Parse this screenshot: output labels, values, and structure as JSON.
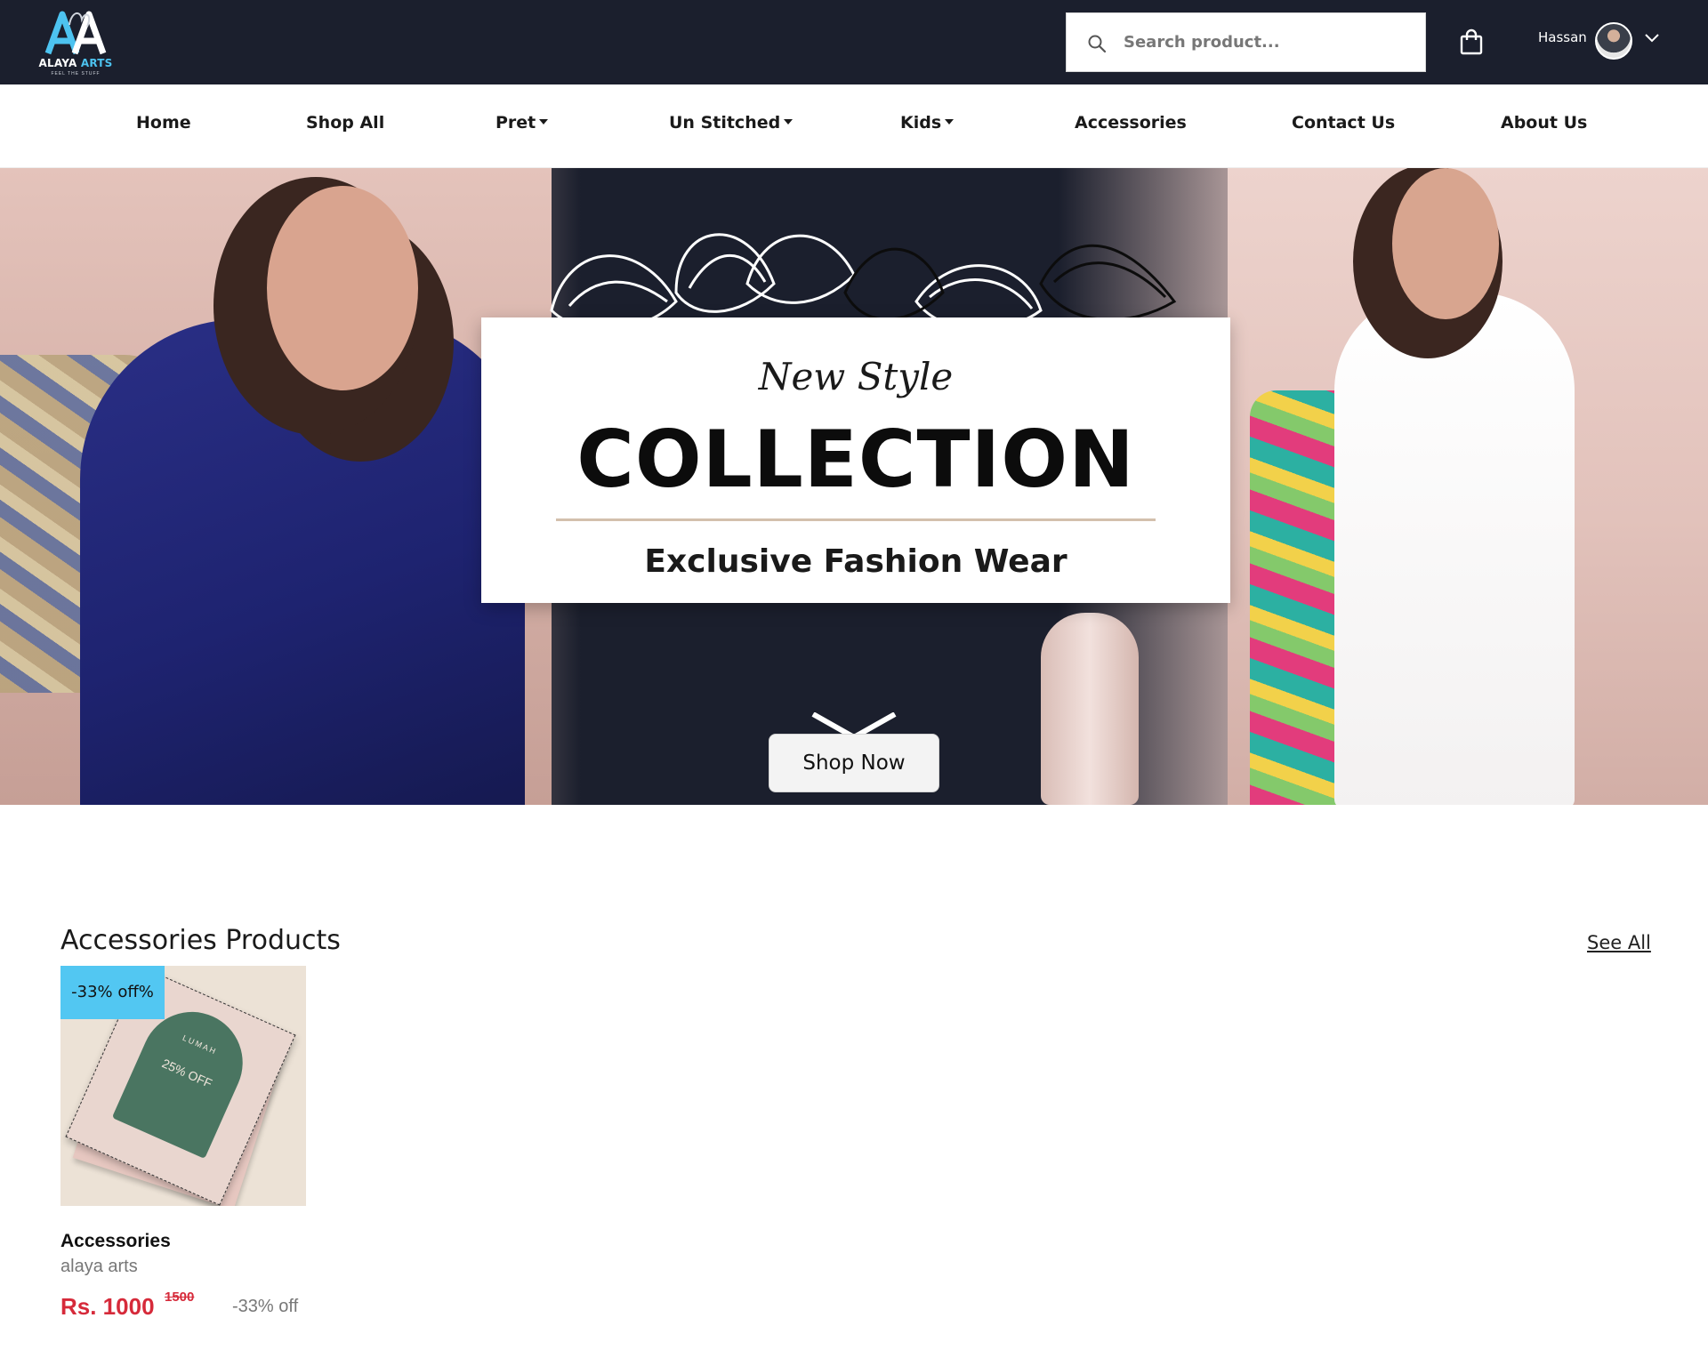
{
  "brand": {
    "name_part1": "ALAYA",
    "name_part2": "ARTS",
    "tagline": "FEEL THE STUFF",
    "accent_color": "#4dc3f0",
    "header_bg": "#1b1f2d"
  },
  "header": {
    "search": {
      "placeholder": "Search product..."
    },
    "cart_icon": "shopping-bag-icon",
    "user": {
      "name": "Hassan",
      "menu_icon": "chevron-down-icon"
    }
  },
  "nav": {
    "items": [
      {
        "label": "Home",
        "dropdown": false
      },
      {
        "label": "Shop All",
        "dropdown": false
      },
      {
        "label": "Pret",
        "dropdown": true
      },
      {
        "label": "Un Stitched",
        "dropdown": true
      },
      {
        "label": "Kids",
        "dropdown": true
      },
      {
        "label": "Accessories",
        "dropdown": false
      },
      {
        "label": "Contact Us",
        "dropdown": false
      },
      {
        "label": "About Us",
        "dropdown": false
      }
    ]
  },
  "hero": {
    "eyebrow": "New Style",
    "title": "COLLECTION",
    "subtitle": "Exclusive Fashion Wear",
    "cta_label": "Shop Now"
  },
  "section": {
    "title": "Accessories Products",
    "see_all_label": "See All"
  },
  "products": [
    {
      "badge": "-33% off%",
      "name": "Accessories",
      "brand": "alaya arts",
      "price": "Rs. 1000",
      "old_price": "1500",
      "discount": "-33% off",
      "image_text": {
        "brand": "LUMAH",
        "sale": "25% OFF"
      }
    }
  ],
  "colors": {
    "price": "#d62a3a",
    "badge": "#52c7f2"
  }
}
